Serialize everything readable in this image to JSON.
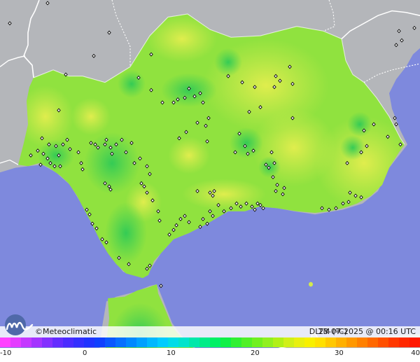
{
  "header": {},
  "credit": "©Meteoclimatic",
  "variable_label": "DLTM (ºC)",
  "timestamp": "23-07-2025 @ 00:16 UTC",
  "colors": {
    "sea": "#7e89dd",
    "land_outside": "#b4b6ba",
    "border": "#ffffff",
    "region_base": "#90e23f",
    "warm_patch": "#d3ea4c",
    "cool_patch": "#3ecf53"
  },
  "legend": {
    "min": -10,
    "max": 40,
    "ticks": [
      "-10",
      "0",
      "10",
      "20",
      "30",
      "40"
    ],
    "colors": [
      "#ff40ff",
      "#e43cff",
      "#c438ff",
      "#a434ff",
      "#8330ff",
      "#632cff",
      "#4a2cff",
      "#3430ff",
      "#2034ff",
      "#1040ff",
      "#0a58ff",
      "#0670ff",
      "#0088ff",
      "#00a0ff",
      "#00b8ff",
      "#00ccff",
      "#00dce8",
      "#00e4cc",
      "#00e8aa",
      "#00ec88",
      "#00f066",
      "#10f048",
      "#30f033",
      "#50f028",
      "#70f020",
      "#90f020",
      "#b0f018",
      "#d0f018",
      "#e8f010",
      "#f8f000",
      "#ffe000",
      "#ffc800",
      "#ffb000",
      "#ff9800",
      "#ff8000",
      "#ff6800",
      "#ff5000",
      "#ff3800",
      "#ff2800",
      "#ff1800"
    ]
  },
  "stations_count": 170
}
